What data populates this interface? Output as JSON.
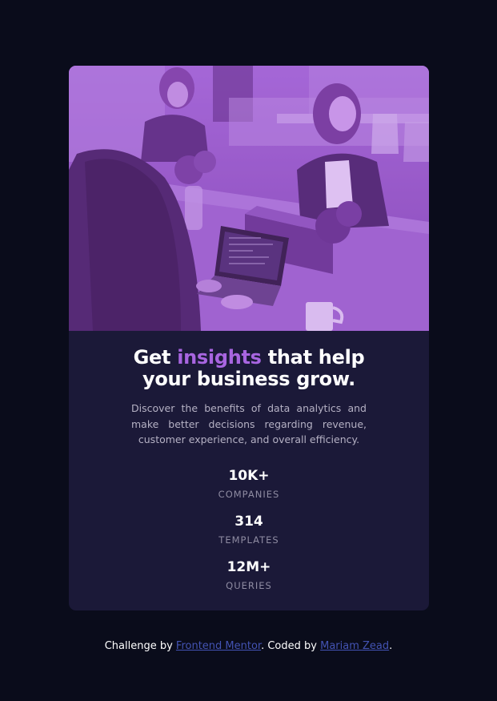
{
  "card": {
    "headline_part1": "Get ",
    "headline_accent": "insights",
    "headline_part2": " that help",
    "headline_line2": "your business grow.",
    "description": "Discover the benefits of data analytics and make better decisions regarding revenue, customer experience, and overall efficiency."
  },
  "stats": [
    {
      "value": "10K+",
      "label": "COMPANIES"
    },
    {
      "value": "314",
      "label": "TEMPLATES"
    },
    {
      "value": "12M+",
      "label": "QUERIES"
    }
  ],
  "footer": {
    "prefix": "Challenge by ",
    "mentor_link": "Frontend Mentor",
    "middle": ". Coded by ",
    "author_link": "Mariam Zead",
    "suffix": "."
  },
  "colors": {
    "background": "#0a0c1b",
    "card": "#1b1938",
    "accent": "#a865e0",
    "link": "#4353b3"
  }
}
